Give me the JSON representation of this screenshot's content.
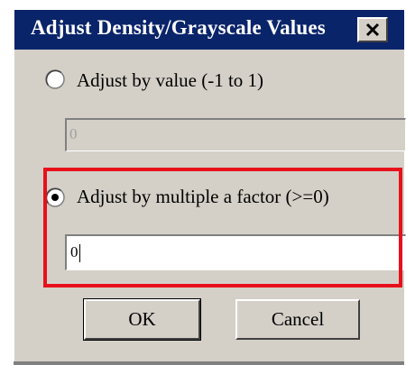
{
  "window": {
    "title": "Adjust Density/Grayscale Values",
    "close_icon": "close-x-icon"
  },
  "options": [
    {
      "label": "Adjust by value (-1 to 1)",
      "selected": false,
      "input_value": "0",
      "input_enabled": false
    },
    {
      "label": "Adjust by multiple a factor (>=0)",
      "selected": true,
      "input_value": "0",
      "input_enabled": true
    }
  ],
  "buttons": {
    "ok_label": "OK",
    "cancel_label": "Cancel"
  },
  "colors": {
    "titlebar": "#0a246a",
    "dialog_bg": "#d4d0c8",
    "highlight": "#e8101a"
  }
}
